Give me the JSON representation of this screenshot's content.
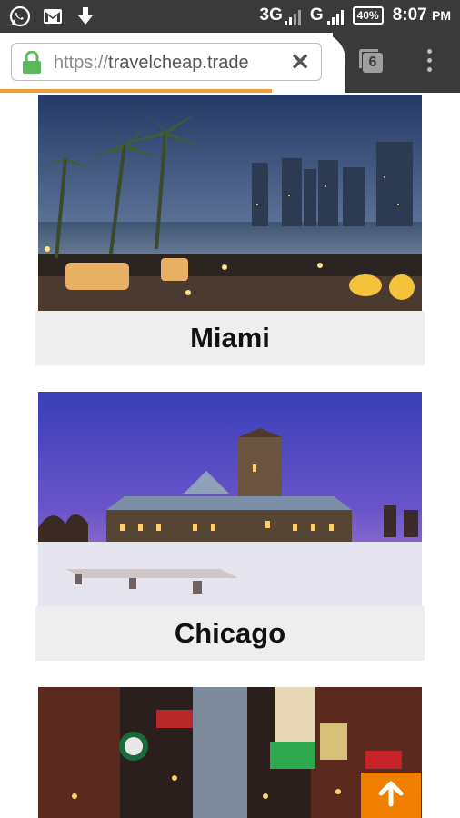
{
  "status_bar": {
    "network_3g": "3G",
    "network_g": "G",
    "battery": "40%",
    "time": "8:07",
    "ampm": "PM"
  },
  "browser": {
    "url_scheme": "https://",
    "url_host": "travelcheap.trade",
    "tab_count": "6",
    "page_load_progress": 0.59
  },
  "destinations": [
    {
      "name": "Miami"
    },
    {
      "name": "Chicago"
    },
    {
      "name": ""
    }
  ],
  "colors": {
    "status_bar": "#3a3a3a",
    "progress": "#f29d38",
    "caption_bg": "#eeeeee",
    "to_top_button": "#f07f00",
    "lock_icon": "#5cb85c"
  },
  "icons": [
    "whatsapp-icon",
    "gmail-icon",
    "download-icon",
    "lock-icon",
    "close-icon",
    "tabs-icon",
    "overflow-menu-icon",
    "arrow-up-icon"
  ]
}
